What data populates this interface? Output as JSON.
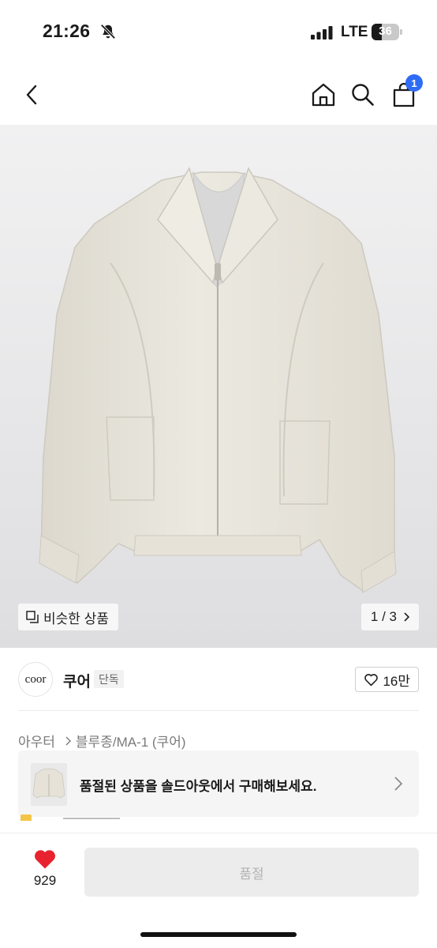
{
  "status_bar": {
    "time": "21:26",
    "network": "LTE",
    "battery": "36"
  },
  "nav": {
    "cart_badge": "1"
  },
  "hero": {
    "similar_label": "비슷한 상품",
    "pager": "1 / 3"
  },
  "brand": {
    "logo_text": "coor",
    "name": "쿠어",
    "tag": "단독",
    "likes": "16만"
  },
  "breadcrumb": {
    "items": [
      "아우터",
      "블루종/MA-1 (쿠어)"
    ]
  },
  "soldout_banner": {
    "text": "품절된 상품을 솔드아웃에서 구매해보세요."
  },
  "bottom_bar": {
    "like_count": "929",
    "button_label": "품절"
  },
  "colors": {
    "accent_blue": "#2f6cf6",
    "heart_red": "#e8232f",
    "jacket_color": "#e8e4da"
  }
}
